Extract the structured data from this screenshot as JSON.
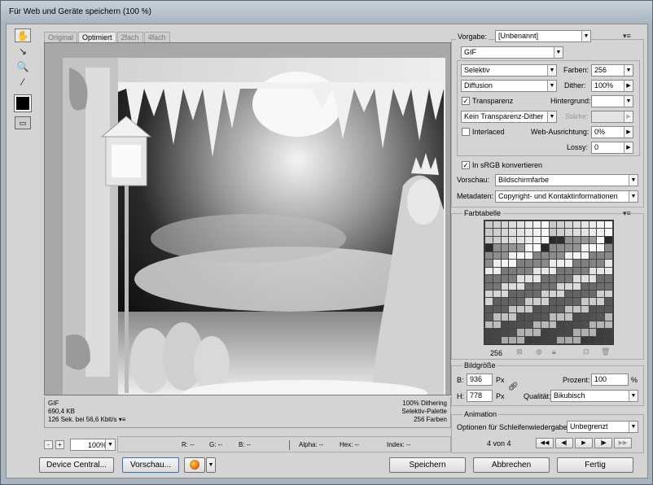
{
  "window": {
    "title": "Für Web und Geräte speichern (100 %)"
  },
  "tools": [
    {
      "icon": "hand-icon",
      "glyph": "✋"
    },
    {
      "icon": "slice-select-icon",
      "glyph": "↘"
    },
    {
      "icon": "zoom-icon",
      "glyph": "🔍"
    },
    {
      "icon": "eyedropper-icon",
      "glyph": "⁄"
    }
  ],
  "tabs": [
    "Original",
    "Optimiert",
    "2fach",
    "4fach"
  ],
  "active_tab": "Optimiert",
  "info": {
    "format": "GIF",
    "size": "690,4 KB",
    "time": "126 Sek. bei 56,6 Kbit/s",
    "dithering": "100% Dithering",
    "palette": "Selektiv-Palette",
    "colors": "256 Farben"
  },
  "zoom": {
    "value": "100%",
    "minus": "-",
    "plus": "+"
  },
  "readout": {
    "r": "R: --",
    "g": "G: --",
    "b": "B: --",
    "alpha": "Alpha: --",
    "hex": "Hex: --",
    "index": "Index: --"
  },
  "buttons": {
    "device_central": "Device Central...",
    "preview": "Vorschau...",
    "save": "Speichern",
    "cancel": "Abbrechen",
    "done": "Fertig"
  },
  "settings": {
    "preset_label": "Vorgabe:",
    "preset_value": "[Unbenannt]",
    "format_value": "GIF",
    "reduction_value": "Selektiv",
    "colors_label": "Farben:",
    "colors_value": "256",
    "dither_algo_value": "Diffusion",
    "dither_label": "Dither:",
    "dither_value": "100%",
    "transparency_label": "Transparenz",
    "transparency_checked": "✓",
    "matte_label": "Hintergrund:",
    "matte_value": "",
    "trans_dither_value": "Kein Transparenz-Dither",
    "amount_label": "Stärke:",
    "interlaced_label": "Interlaced",
    "websnap_label": "Web-Ausrichtung:",
    "websnap_value": "0%",
    "lossy_label": "Lossy:",
    "lossy_value": "0",
    "srgb_label": "In sRGB konvertieren",
    "srgb_checked": "✓",
    "preview_label": "Vorschau:",
    "preview_value": "Bildschirmfarbe",
    "metadata_label": "Metadaten:",
    "metadata_value": "Copyright- und Kontaktinformationen"
  },
  "colortable": {
    "title": "Farbtabelle",
    "count": "256"
  },
  "imagesize": {
    "title": "Bildgröße",
    "w_label": "B:",
    "w_value": "936",
    "h_label": "H:",
    "h_value": "778",
    "unit": "Px",
    "percent_label": "Prozent:",
    "percent_value": "100",
    "percent_unit": "%",
    "quality_label": "Qualität:",
    "quality_value": "Bikubisch"
  },
  "animation": {
    "title": "Animation",
    "loop_label": "Optionen für Schleifenwiedergabe:",
    "loop_value": "Unbegrenzt",
    "frame": "4 von 4"
  }
}
